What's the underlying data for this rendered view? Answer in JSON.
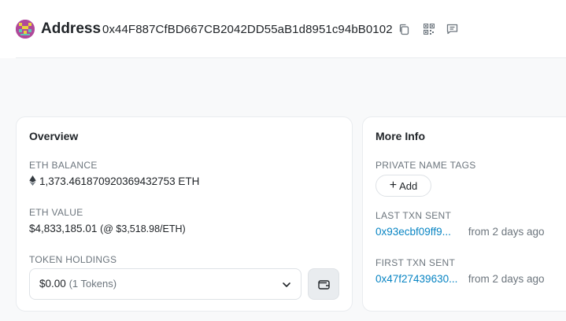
{
  "header": {
    "label": "Address",
    "address": "0x44F887CfBD667CB2042DD55aB1d8951c94bB0102",
    "icons": [
      "copy-icon",
      "qr-code-icon",
      "comment-icon"
    ]
  },
  "overview": {
    "title": "Overview",
    "eth_balance_label": "ETH BALANCE",
    "eth_balance_value": "1,373.461870920369432753 ETH",
    "eth_value_label": "ETH VALUE",
    "eth_value_amount": "$4,833,185.01",
    "eth_value_rate": "(@ $3,518.98/ETH)",
    "token_holdings_label": "TOKEN HOLDINGS",
    "token_holdings_value": "$0.00",
    "token_holdings_count": "(1 Tokens)"
  },
  "more_info": {
    "title": "More Info",
    "private_tags_label": "PRIVATE NAME TAGS",
    "add_label": "Add",
    "last_txn_label": "LAST TXN SENT",
    "last_txn_hash": "0x93ecbf09ff9...",
    "last_txn_ago": "from 2 days ago",
    "first_txn_label": "FIRST TXN SENT",
    "first_txn_hash": "0x47f27439630...",
    "first_txn_ago": "from 2 days ago"
  },
  "colors": {
    "link": "#0784c3",
    "muted": "#6c757d",
    "avatar": "#b0489a"
  }
}
